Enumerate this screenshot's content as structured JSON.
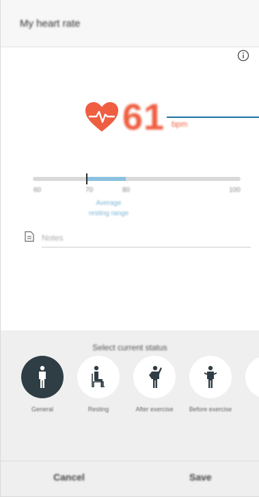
{
  "header": {
    "title": "My heart rate"
  },
  "measurement": {
    "value": "61",
    "unit": "bpm"
  },
  "range": {
    "ticks": [
      "60",
      "70",
      "80",
      "100"
    ],
    "caption_line1": "Average",
    "caption_line2": "resting range",
    "marker_value": 61,
    "fill_from": 61,
    "fill_to": 80,
    "axis_min": 40,
    "axis_max": 100
  },
  "note": {
    "placeholder": "Notes"
  },
  "status": {
    "title": "Select current status",
    "options": [
      {
        "label": "General",
        "icon": "standing-person-icon",
        "selected": true
      },
      {
        "label": "Resting",
        "icon": "sitting-person-icon",
        "selected": false
      },
      {
        "label": "After exercise",
        "icon": "exercise-person-icon",
        "selected": false
      },
      {
        "label": "Before exercise",
        "icon": "stretching-person-icon",
        "selected": false
      },
      {
        "label": "",
        "icon": "more-status-icon",
        "selected": false
      }
    ]
  },
  "footer": {
    "cancel": "Cancel",
    "save": "Save"
  },
  "colors": {
    "accent": "#ef5e41",
    "range_fill": "#8cc2df",
    "selected_status": "#2f3d44",
    "callout": "#1a6fa6"
  }
}
